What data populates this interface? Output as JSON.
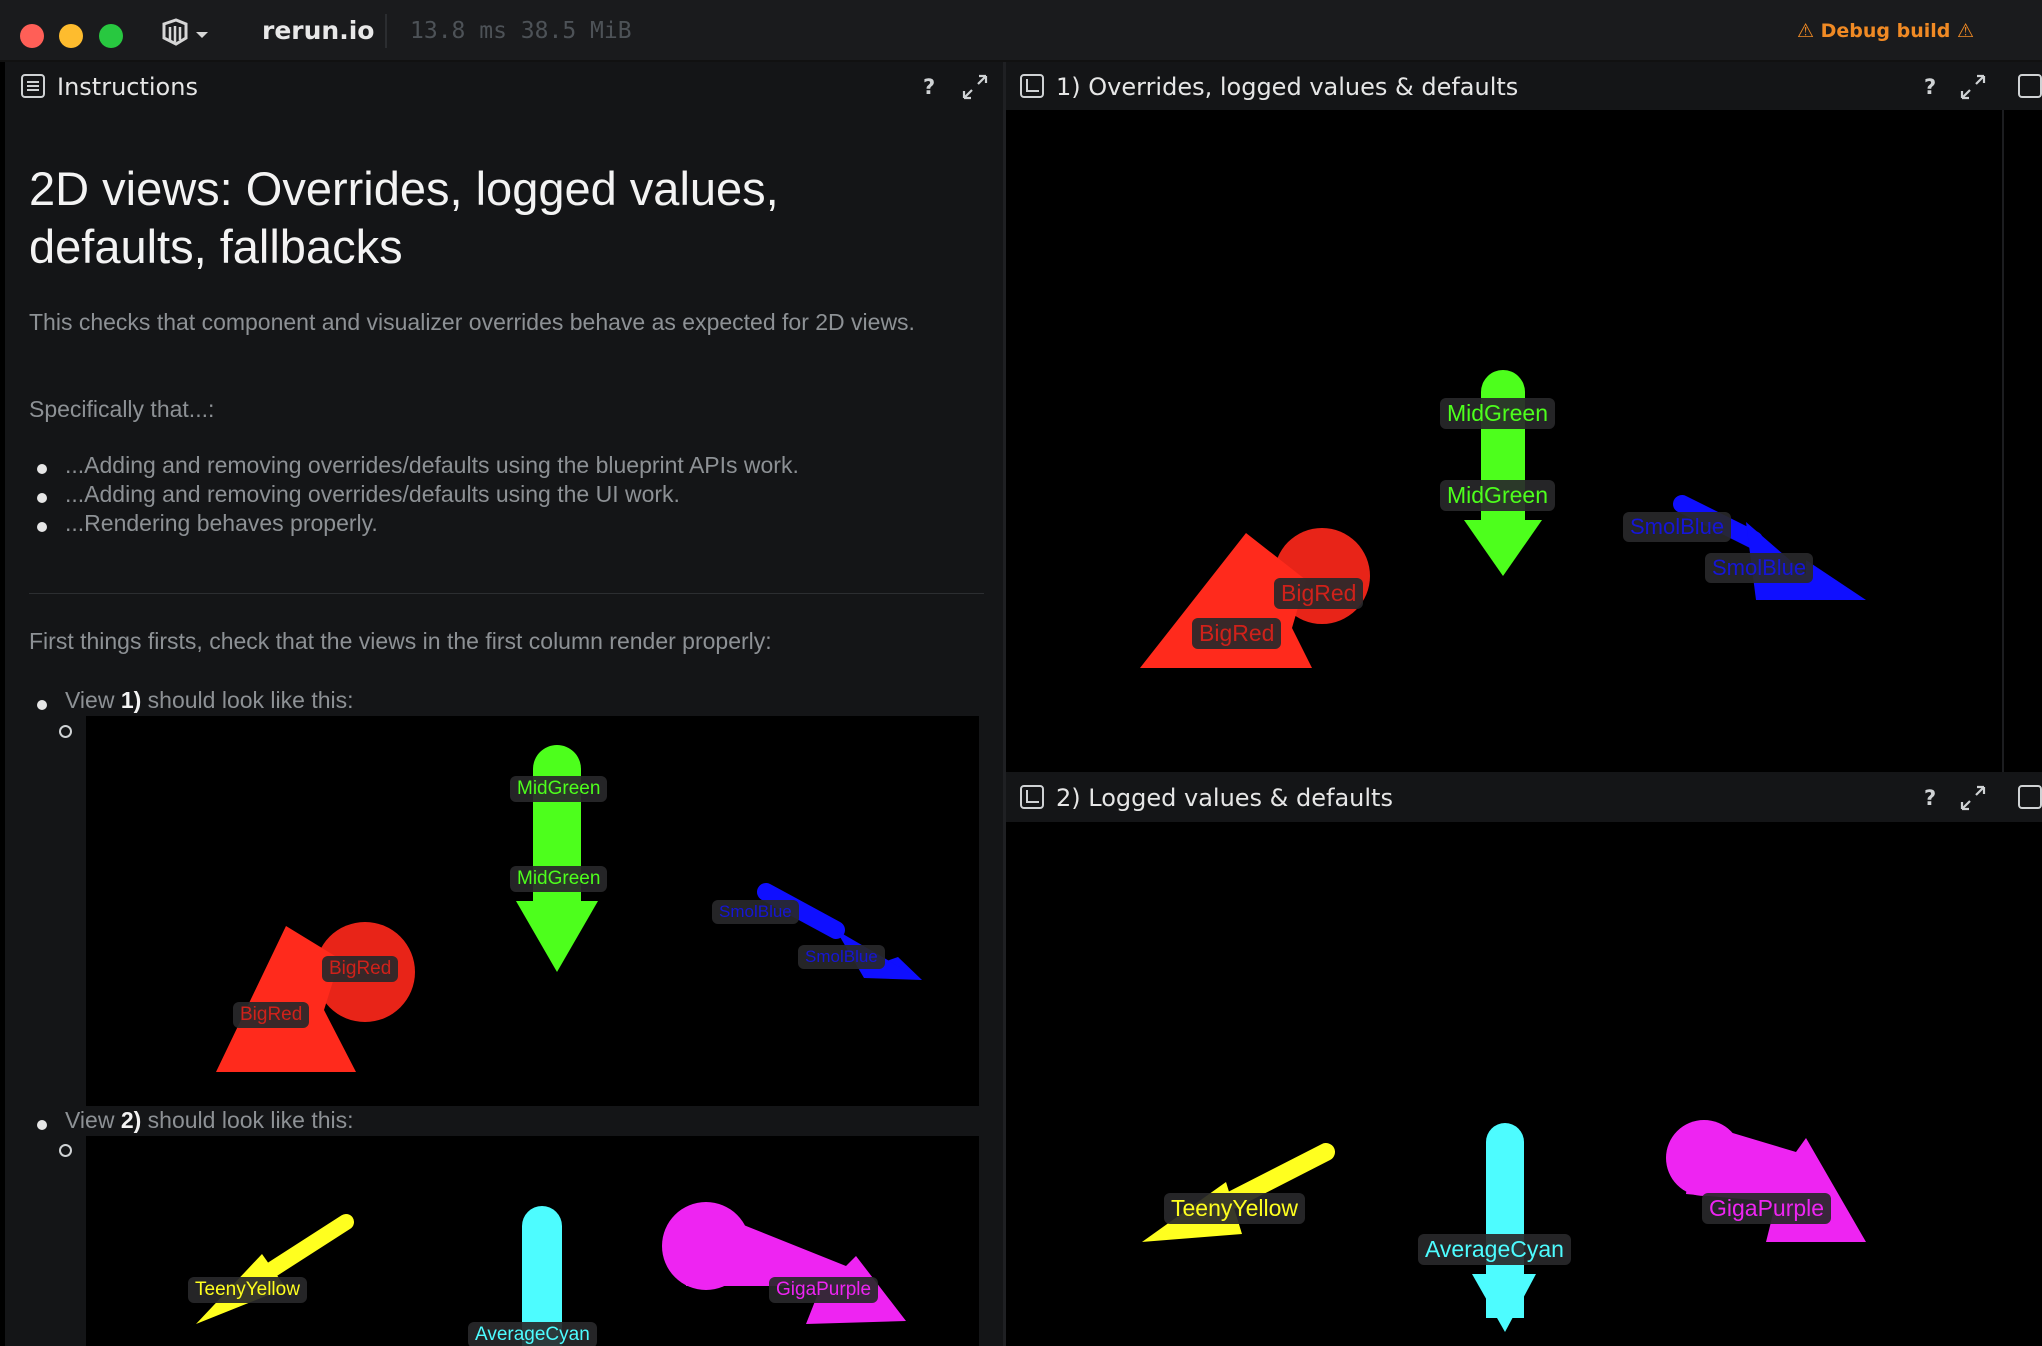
{
  "app": {
    "name": "rerun.io",
    "perf": "13.8 ms  38.5 MiB",
    "debug_badge": "⚠ Debug build ⚠"
  },
  "instructions_panel": {
    "title": "Instructions",
    "help": "?",
    "heading": "2D views: Overrides, logged values, defaults, fallbacks",
    "intro": "This checks that component and visualizer overrides behave as expected for 2D views.",
    "specifically": "Specifically that...:",
    "bullets": [
      "...Adding and removing overrides/defaults using the blueprint APIs work.",
      "...Adding and removing overrides/defaults using the UI work.",
      "...Rendering behaves properly."
    ],
    "first_things": "First things firsts, check that the views in the first column render properly:",
    "view1_pre": "View ",
    "view1_strong": "1)",
    "view1_post": " should look like this:",
    "view2_pre": "View ",
    "view2_strong": "2)",
    "view2_post": " should look like this:"
  },
  "view1": {
    "title": "1) Overrides, logged values & defaults",
    "help": "?",
    "labels": {
      "mid_green_top": "MidGreen",
      "mid_green_bottom": "MidGreen",
      "big_red_top": "BigRed",
      "big_red_bottom": "BigRed",
      "smol_blue_top": "SmolBlue",
      "smol_blue_bottom": "SmolBlue"
    }
  },
  "view2": {
    "title": "2) Logged values & defaults",
    "help": "?",
    "labels": {
      "teeny_yellow": "TeenyYellow",
      "average_cyan": "AverageCyan",
      "giga_purple": "GigaPurple"
    }
  },
  "colors": {
    "red": "#ff2a1c",
    "green": "#4dff1c",
    "blue": "#0f0fff",
    "yellow": "#ffff1f",
    "cyan": "#4dfcff",
    "purple": "#ee24f2",
    "accent_warning": "#f08a24"
  }
}
